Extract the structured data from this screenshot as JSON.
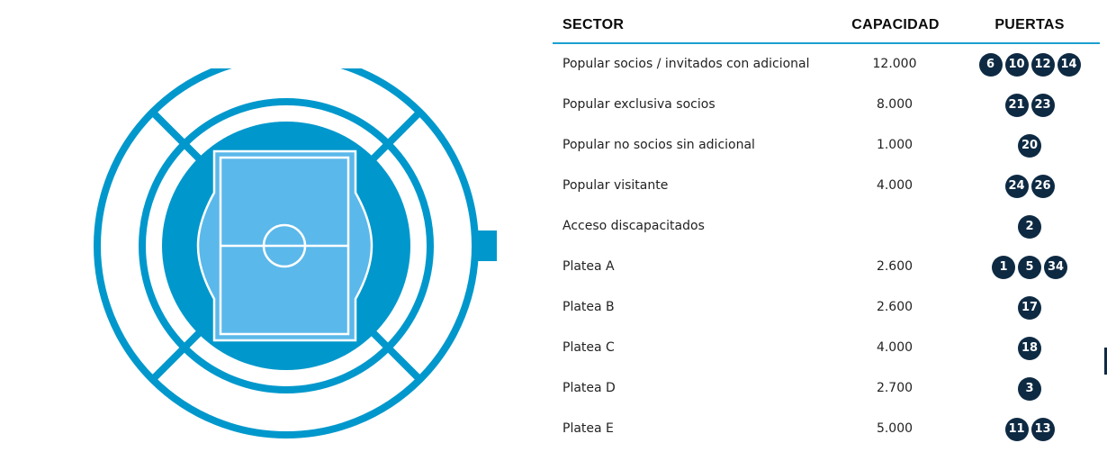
{
  "colors": {
    "accent": "#009ACE",
    "ring_dark": "#0098CC",
    "pitch": "#5BB8EA",
    "gate_badge": "#0E2A43",
    "header_line": "#1B9FD0"
  },
  "table": {
    "headers": {
      "sector": "SECTOR",
      "capacidad": "CAPACIDAD",
      "puertas": "PUERTAS"
    },
    "rows": [
      {
        "sector": "Popular socios / invitados con adicional",
        "capacidad": "12.000",
        "puertas": [
          "6",
          "10",
          "12",
          "14"
        ]
      },
      {
        "sector": "Popular exclusiva socios",
        "capacidad": "8.000",
        "puertas": [
          "21",
          "23"
        ]
      },
      {
        "sector": "Popular no socios sin adicional",
        "capacidad": "1.000",
        "puertas": [
          "20"
        ]
      },
      {
        "sector": "Popular visitante",
        "capacidad": "4.000",
        "puertas": [
          "24",
          "26"
        ]
      },
      {
        "sector": "Acceso discapacitados",
        "capacidad": "",
        "puertas": [
          "2"
        ]
      },
      {
        "sector": "Platea A",
        "capacidad": "2.600",
        "puertas": [
          "1",
          "5",
          "34"
        ]
      },
      {
        "sector": "Platea B",
        "capacidad": "2.600",
        "puertas": [
          "17"
        ]
      },
      {
        "sector": "Platea C",
        "capacidad": "4.000",
        "puertas": [
          "18"
        ]
      },
      {
        "sector": "Platea D",
        "capacidad": "2.700",
        "puertas": [
          "3"
        ]
      },
      {
        "sector": "Platea E",
        "capacidad": "5.000",
        "puertas": [
          "11",
          "13"
        ]
      }
    ]
  },
  "stadium_map": {
    "icon": "stadium-map-icon"
  }
}
